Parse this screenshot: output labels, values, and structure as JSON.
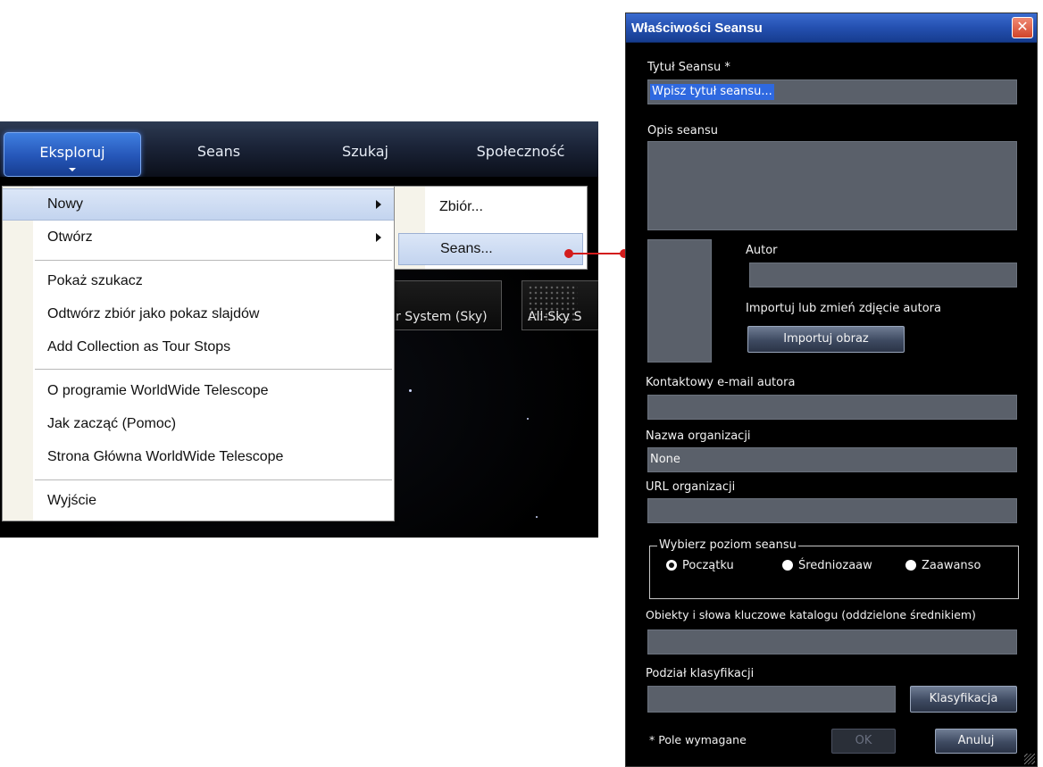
{
  "nav": {
    "tabs": [
      {
        "label": "Eksploruj",
        "active": true
      },
      {
        "label": "Seans"
      },
      {
        "label": "Szukaj"
      },
      {
        "label": "Społeczność"
      }
    ]
  },
  "thumbnails": [
    {
      "label": "r System (Sky)"
    },
    {
      "label": "All-Sky S"
    }
  ],
  "main_menu": {
    "items": {
      "new": "Nowy",
      "open": "Otwórz",
      "show_finder": "Pokaż szukacz",
      "play_slideshow": "Odtwórz zbiór jako pokaz slajdów",
      "add_collection": "Add Collection as Tour Stops",
      "about": "O programie WorldWide Telescope",
      "getting_started": "Jak zacząć (Pomoc)",
      "homepage": "Strona Główna WorldWide Telescope",
      "exit": "Wyjście"
    }
  },
  "sub_menu": {
    "collection": "Zbiór...",
    "tour": "Seans..."
  },
  "dialog": {
    "title": "Właściwości Seansu",
    "close_glyph": "✕",
    "tour_title_label": "Tytuł Seansu *",
    "tour_title_value": "Wpisz tytuł seansu...",
    "description_label": "Opis seansu",
    "description_value": "",
    "author_label": "Autor",
    "author_value": "",
    "import_photo_label": "Importuj lub zmień zdjęcie autora",
    "import_image_button": "Importuj obraz",
    "email_label": "Kontaktowy e-mail autora",
    "email_value": "",
    "org_name_label": "Nazwa organizacji",
    "org_name_value": "None",
    "org_url_label": "URL organizacji",
    "org_url_value": "",
    "level_group_label": "Wybierz poziom seansu",
    "levels": [
      {
        "label": "Początku",
        "checked": true
      },
      {
        "label": "Średniozaaw",
        "checked": false
      },
      {
        "label": "Zaawanso",
        "checked": false
      }
    ],
    "keywords_label": "Obiekty i słowa kluczowe katalogu (oddzielone średnikiem)",
    "keywords_value": "",
    "classification_label": "Podział klasyfikacji",
    "classification_value": "",
    "classification_button": "Klasyfikacja",
    "required_note": "* Pole wymagane",
    "ok_button": "OK",
    "cancel_button": "Anuluj"
  },
  "colors": {
    "accent_blue": "#2556b8",
    "connector_red": "#d31c1c",
    "field_gray": "#5a606a"
  }
}
